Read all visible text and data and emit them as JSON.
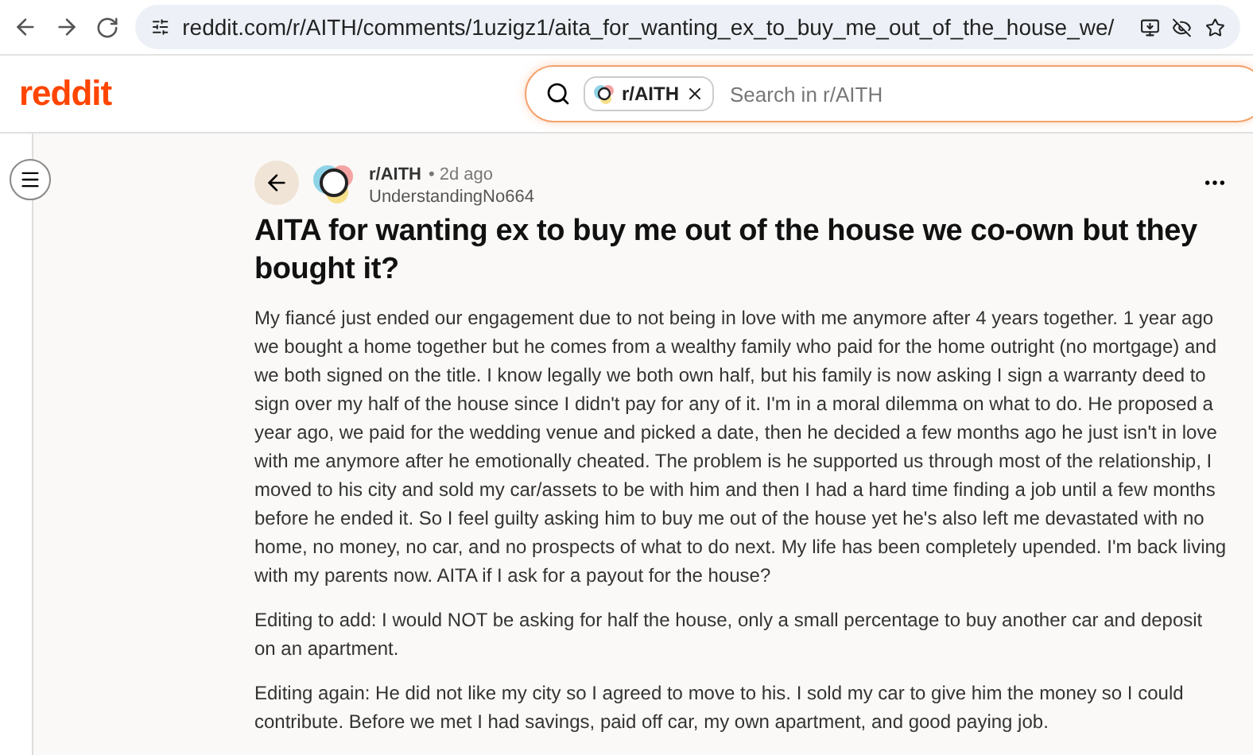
{
  "browser": {
    "url": "reddit.com/r/AITH/comments/1uzigz1/aita_for_wanting_ex_to_buy_me_out_of_the_house_we/"
  },
  "header": {
    "logo": "reddit",
    "search": {
      "chip": "r/AITH",
      "placeholder": "Search in r/AITH"
    }
  },
  "post": {
    "subreddit": "r/AITH",
    "age": "• 2d ago",
    "author": "UnderstandingNo664",
    "title": "AITA for wanting ex to buy me out of the house we co-own but they bought it?",
    "paragraphs": [
      "My fiancé just ended our engagement due to not being in love with me anymore after 4 years together. 1 year ago we bought a home together but he comes from a wealthy family who paid for the home outright (no mortgage) and we both signed on the title. I know legally we both own half, but his family is now asking I sign a warranty deed to sign over my half of the house since I didn't pay for any of it. I'm in a moral dilemma on what to do. He proposed a year ago, we paid for the wedding venue and picked a date, then he decided a few months ago he just isn't in love with me anymore after he emotionally cheated. The problem is he supported us through most of the relationship, I moved to his city and sold my car/assets to be with him and then I had a hard time finding a job until a few months before he ended it. So I feel guilty asking him to buy me out of the house yet he's also left me devastated with no home, no money, no car, and no prospects of what to do next. My life has been completely upended. I'm back living with my parents now. AITA if I ask for a payout for the house?",
      "Editing to add: I would NOT be asking for half the house, only a small percentage to buy another car and deposit on an apartment.",
      "Editing again: He did not like my city so I agreed to move to his. I sold my car to give him the money so I could contribute. Before we met I had savings, paid off car, my own apartment, and good paying job."
    ]
  }
}
